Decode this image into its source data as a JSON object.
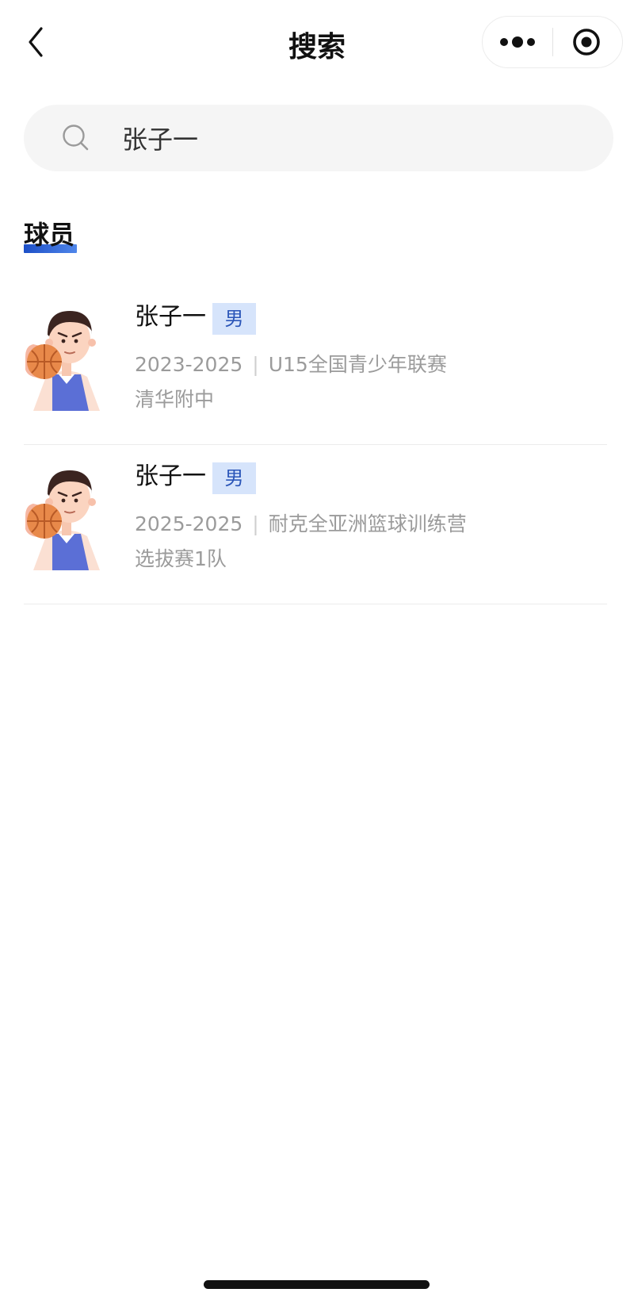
{
  "nav": {
    "title": "搜索",
    "back_icon": "chevron-left-icon",
    "more_icon": "more-dots-icon",
    "target_icon": "target-circle-icon"
  },
  "search": {
    "value": "张子一",
    "icon": "search-icon"
  },
  "section": {
    "title": "球员",
    "accent_color": "#2f66d9"
  },
  "players": [
    {
      "name": "张子一",
      "gender": "男",
      "years": "2023-2025",
      "event": "U15全国青少年联赛",
      "team": "清华附中",
      "avatar_icon": "basketball-player-avatar"
    },
    {
      "name": "张子一",
      "gender": "男",
      "years": "2025-2025",
      "event": "耐克全亚洲篮球训练营",
      "team": "选拔赛1队",
      "avatar_icon": "basketball-player-avatar"
    }
  ]
}
